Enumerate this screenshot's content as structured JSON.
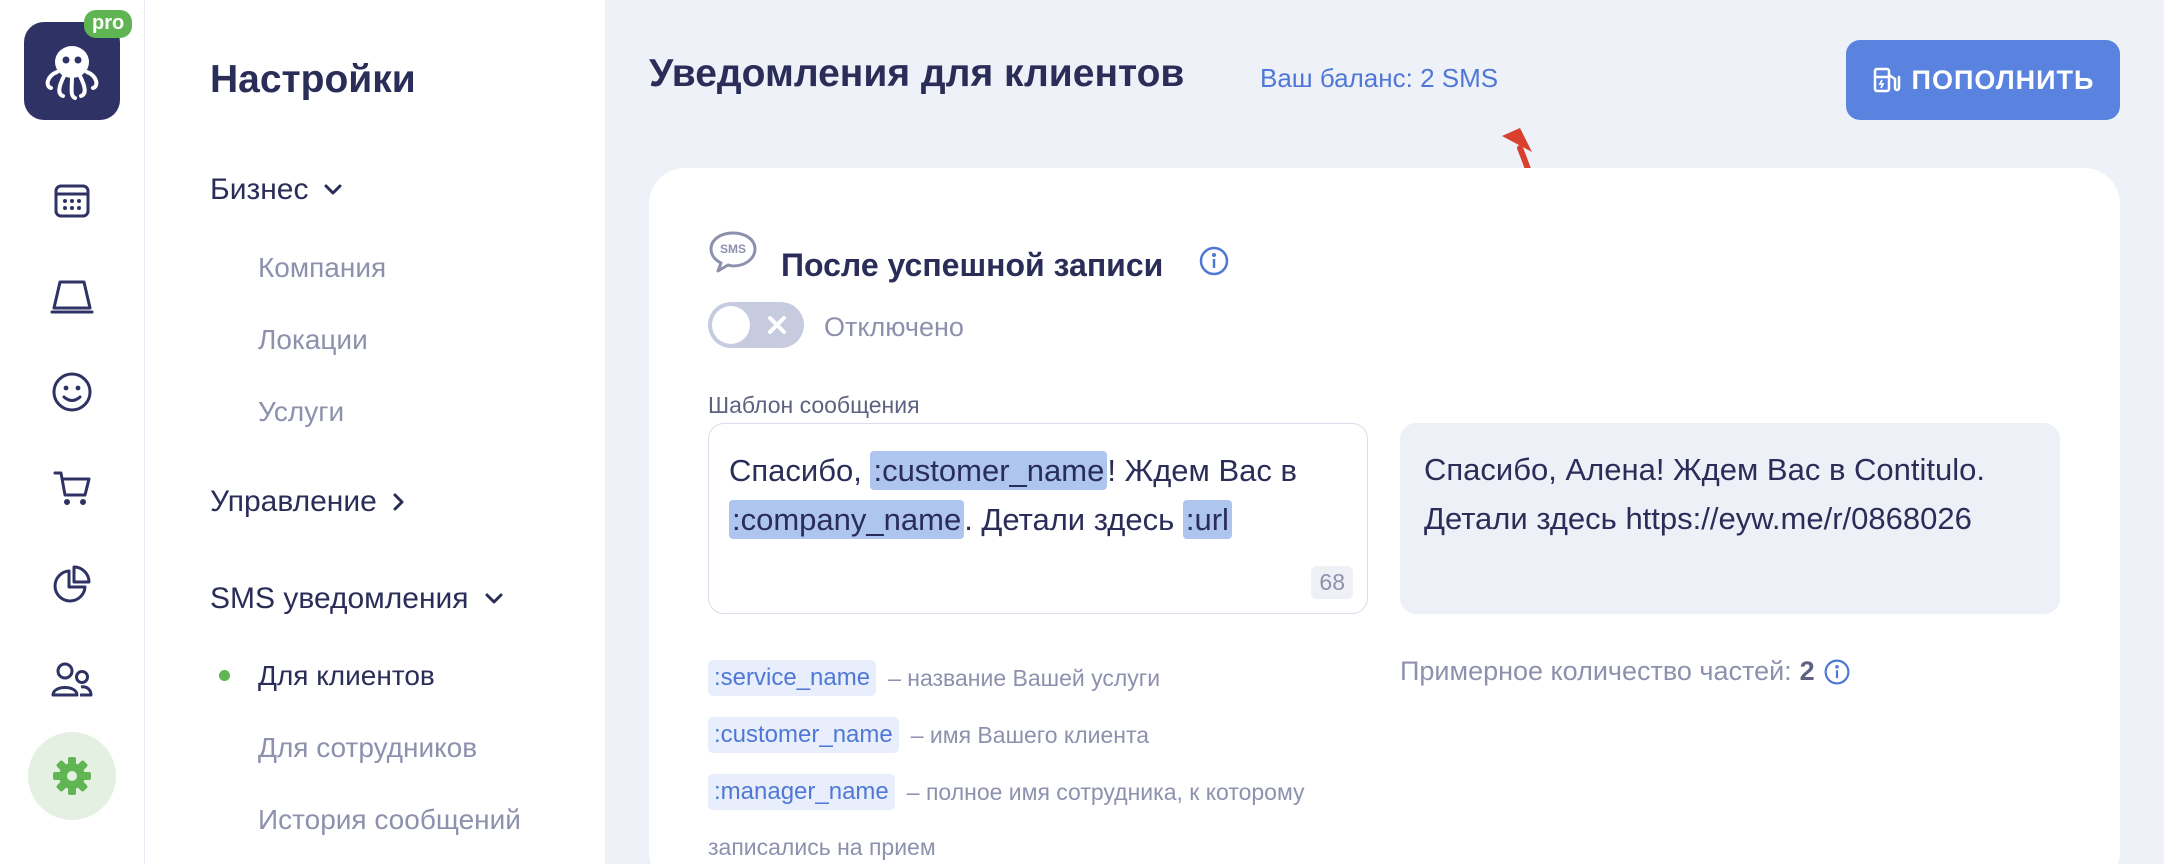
{
  "rail": {
    "badge": "pro",
    "icons": [
      "octopus-logo",
      "calendar-icon",
      "notebook-icon",
      "smiley-icon",
      "cart-icon",
      "pie-chart-icon",
      "users-icon",
      "gear-icon"
    ]
  },
  "sidebar": {
    "title": "Настройки",
    "groups": [
      {
        "label": "Бизнес",
        "items": [
          "Компания",
          "Локации",
          "Услуги"
        ]
      },
      {
        "label": "Управление"
      },
      {
        "label": "SMS уведомления",
        "items": [
          "Для клиентов",
          "Для сотрудников",
          "История сообщений"
        ]
      }
    ]
  },
  "header": {
    "title": "Уведомления для клиентов",
    "balance": "Ваш баланс: 2 SMS",
    "topup_label": "ПОПОЛНИТЬ"
  },
  "card": {
    "title": "После успешной записи",
    "toggle_label": "Отключено",
    "template_label": "Шаблон сообщения",
    "template_parts": [
      "Спасибо, ",
      ":customer_name",
      "! Ждем Вас в ",
      ":company_name",
      ". Детали здесь ",
      ":url"
    ],
    "char_count": "68",
    "preview": "Спасибо, Алена! Ждем Вас в Contitulo. Детали здесь https://eyw.me/r/0868026",
    "variables": [
      {
        "name": ":service_name",
        "desc": "– название Вашей услуги"
      },
      {
        "name": ":customer_name",
        "desc": "– имя Вашего клиента"
      },
      {
        "name": ":manager_name",
        "desc": "– полное имя сотрудника, к которому"
      }
    ],
    "variable_continuation": "записались на прием",
    "parts_label": "Примерное количество частей:",
    "parts_value": "2"
  },
  "colors": {
    "accent": "#5a83e0",
    "active_dot": "#5fb551",
    "brand_dark": "#2f3264",
    "arrow": "#d9402e"
  }
}
